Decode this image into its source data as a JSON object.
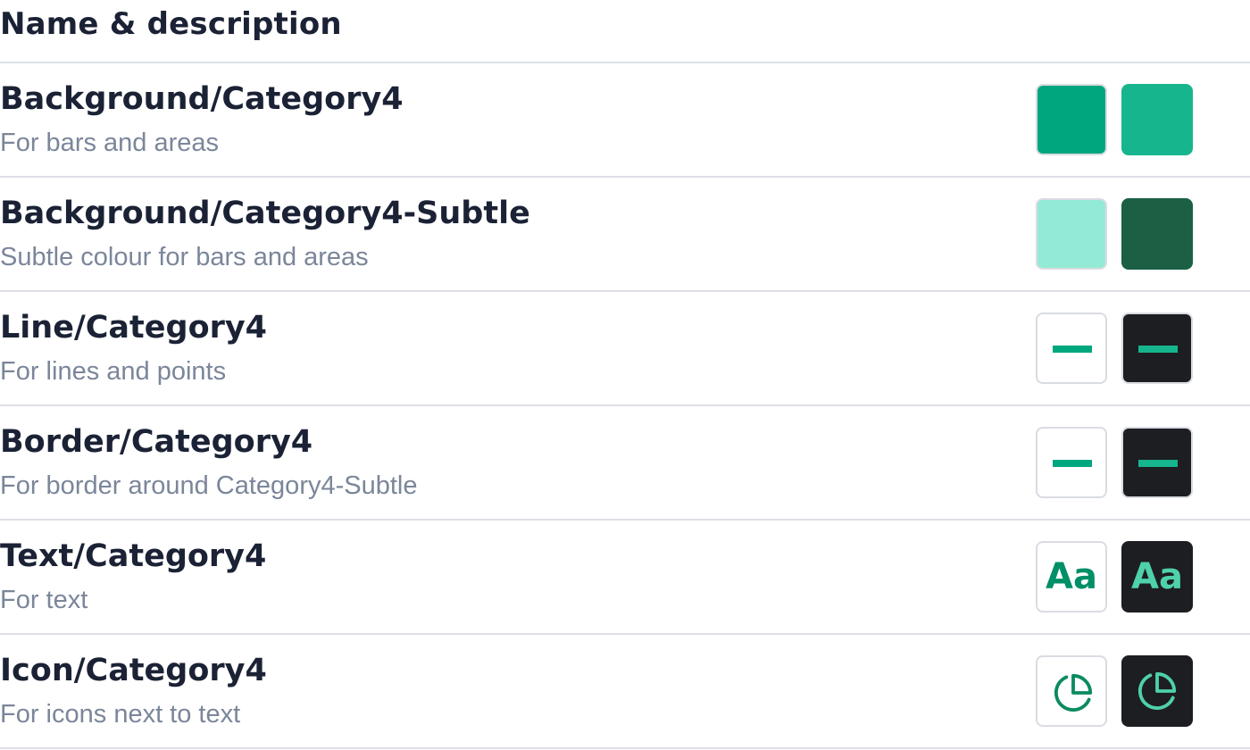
{
  "header": {
    "title": "Name & description"
  },
  "colors": {
    "light_surface": "#ffffff",
    "dark_surface": "#1d1e22",
    "swatch_border": "#d9dce2",
    "category4": "#00a67e",
    "category4_dark": "#17b58e",
    "category4_subtle": "#93ead5",
    "category4_subtle_dark": "#1b6045",
    "text_light": "#008f67",
    "text_dark": "#4fd1ab",
    "icon_light": "#0b8b5f",
    "icon_dark": "#4fd1ab"
  },
  "tokens": [
    {
      "name": "Background/Category4",
      "description": "For bars and areas",
      "preview": "fill",
      "light_color": "#00a67e",
      "dark_color": "#17b58e"
    },
    {
      "name": "Background/Category4-Subtle",
      "description": "Subtle colour for bars and areas",
      "preview": "fill",
      "light_color": "#93ead5",
      "dark_color": "#1b6045"
    },
    {
      "name": "Line/Category4",
      "description": "For lines and points",
      "preview": "line",
      "light_color": "#00a67e",
      "dark_color": "#17b58e"
    },
    {
      "name": "Border/Category4",
      "description": "For border around Category4-Subtle",
      "preview": "line",
      "light_color": "#00a67e",
      "dark_color": "#17b58e"
    },
    {
      "name": "Text/Category4",
      "description": "For text",
      "preview": "text",
      "sample": "Aa",
      "light_color": "#008f67",
      "dark_color": "#4fd1ab"
    },
    {
      "name": "Icon/Category4",
      "description": "For icons next to text",
      "preview": "icon",
      "icon": "pie-chart-icon",
      "light_color": "#0b8b5f",
      "dark_color": "#4fd1ab"
    }
  ]
}
